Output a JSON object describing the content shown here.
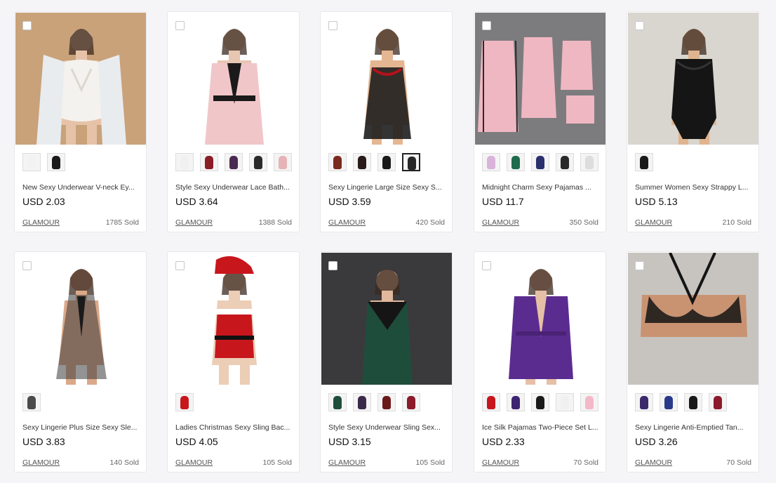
{
  "products": [
    {
      "title": "New Sexy Underwear V-neck Ey...",
      "price": "USD 2.03",
      "store": "GLAMOUR",
      "sold": "1785 Sold",
      "bg": "#c9a27a",
      "garment": "#f4f2ee",
      "skin": "#e6c3a8",
      "style": "white-lace",
      "swatches": [
        "#f2f2f2",
        "#1a1a1a"
      ]
    },
    {
      "title": "Style Sexy Underwear Lace Bath...",
      "price": "USD 3.64",
      "store": "GLAMOUR",
      "sold": "1388 Sold",
      "bg": "#ffffff",
      "garment": "#f1c6c9",
      "skin": "#e7c6b2",
      "style": "pink-robe",
      "swatches": [
        "#f0f0f0",
        "#8b1d24",
        "#4b2a52",
        "#2a2a2a",
        "#e6b3b7"
      ]
    },
    {
      "title": "Sexy Lingerie Large Size Sexy S...",
      "price": "USD 3.59",
      "store": "GLAMOUR",
      "sold": "420 Sold",
      "bg": "#ffffff",
      "garment": "#1e1e1e",
      "skin": "#e4b692",
      "style": "black-babydoll",
      "swatches": [
        "#7a2a1e",
        "#2a1a1a",
        "#1a1a1a",
        "#262626"
      ],
      "selected": 3
    },
    {
      "title": "Midnight Charm Sexy Pajamas ...",
      "price": "USD 11.7",
      "store": "GLAMOUR",
      "sold": "350 Sold",
      "bg": "#7c7c7e",
      "garment": "#efb7c2",
      "skin": "#e0b0b8",
      "style": "pink-set",
      "swatches": [
        "#d9b3d9",
        "#1f6b4d",
        "#2a2f6e",
        "#2a2a2a",
        "#dddddd"
      ]
    },
    {
      "title": "Summer Women Sexy Strappy L...",
      "price": "USD 5.13",
      "store": "GLAMOUR",
      "sold": "210 Sold",
      "bg": "#d9d5cf",
      "garment": "#151515",
      "skin": "#e0b48f",
      "style": "black-bodysuit",
      "swatches": [
        "#1a1a1a"
      ]
    },
    {
      "title": "Sexy Lingerie Plus Size Sexy Sle...",
      "price": "USD 3.83",
      "store": "GLAMOUR",
      "sold": "140 Sold",
      "bg": "#ffffff",
      "garment": "#3a3a3a",
      "skin": "#dba98a",
      "style": "sheer-gown",
      "swatches": [
        "#4a4a4a"
      ]
    },
    {
      "title": "Ladies Christmas Sexy Sling Bac...",
      "price": "USD 4.05",
      "store": "GLAMOUR",
      "sold": "105 Sold",
      "bg": "#ffffff",
      "garment": "#c8161d",
      "skin": "#eccdb6",
      "style": "christmas",
      "swatches": [
        "#c8161d"
      ]
    },
    {
      "title": "Style Sexy Underwear Sling Sex...",
      "price": "USD 3.15",
      "store": "GLAMOUR",
      "sold": "105 Sold",
      "bg": "#3a3a3c",
      "garment": "#1f4d3b",
      "skin": "#e1b89c",
      "style": "green-slip",
      "swatches": [
        "#1f4d3b",
        "#3a2a4a",
        "#6b1a1a",
        "#8b1a2a"
      ]
    },
    {
      "title": "Ice Silk Pajamas Two-Piece Set L...",
      "price": "USD 2.33",
      "store": "GLAMOUR",
      "sold": "70 Sold",
      "bg": "#ffffff",
      "garment": "#5b2c8f",
      "skin": "#e6c0a6",
      "style": "purple-robe",
      "swatches": [
        "#c8161d",
        "#3d2470",
        "#1a1a1a",
        "#f0f0f0",
        "#f3b9c8"
      ]
    },
    {
      "title": "Sexy Lingerie Anti-Emptied Tan...",
      "price": "USD 3.26",
      "store": "GLAMOUR",
      "sold": "70 Sold",
      "bg": "#c7c4c0",
      "garment": "#141414",
      "skin": "#c99372",
      "style": "black-bralette",
      "swatches": [
        "#3a2a6b",
        "#2a3a8b",
        "#1a1a1a",
        "#8b1a2a"
      ]
    }
  ]
}
